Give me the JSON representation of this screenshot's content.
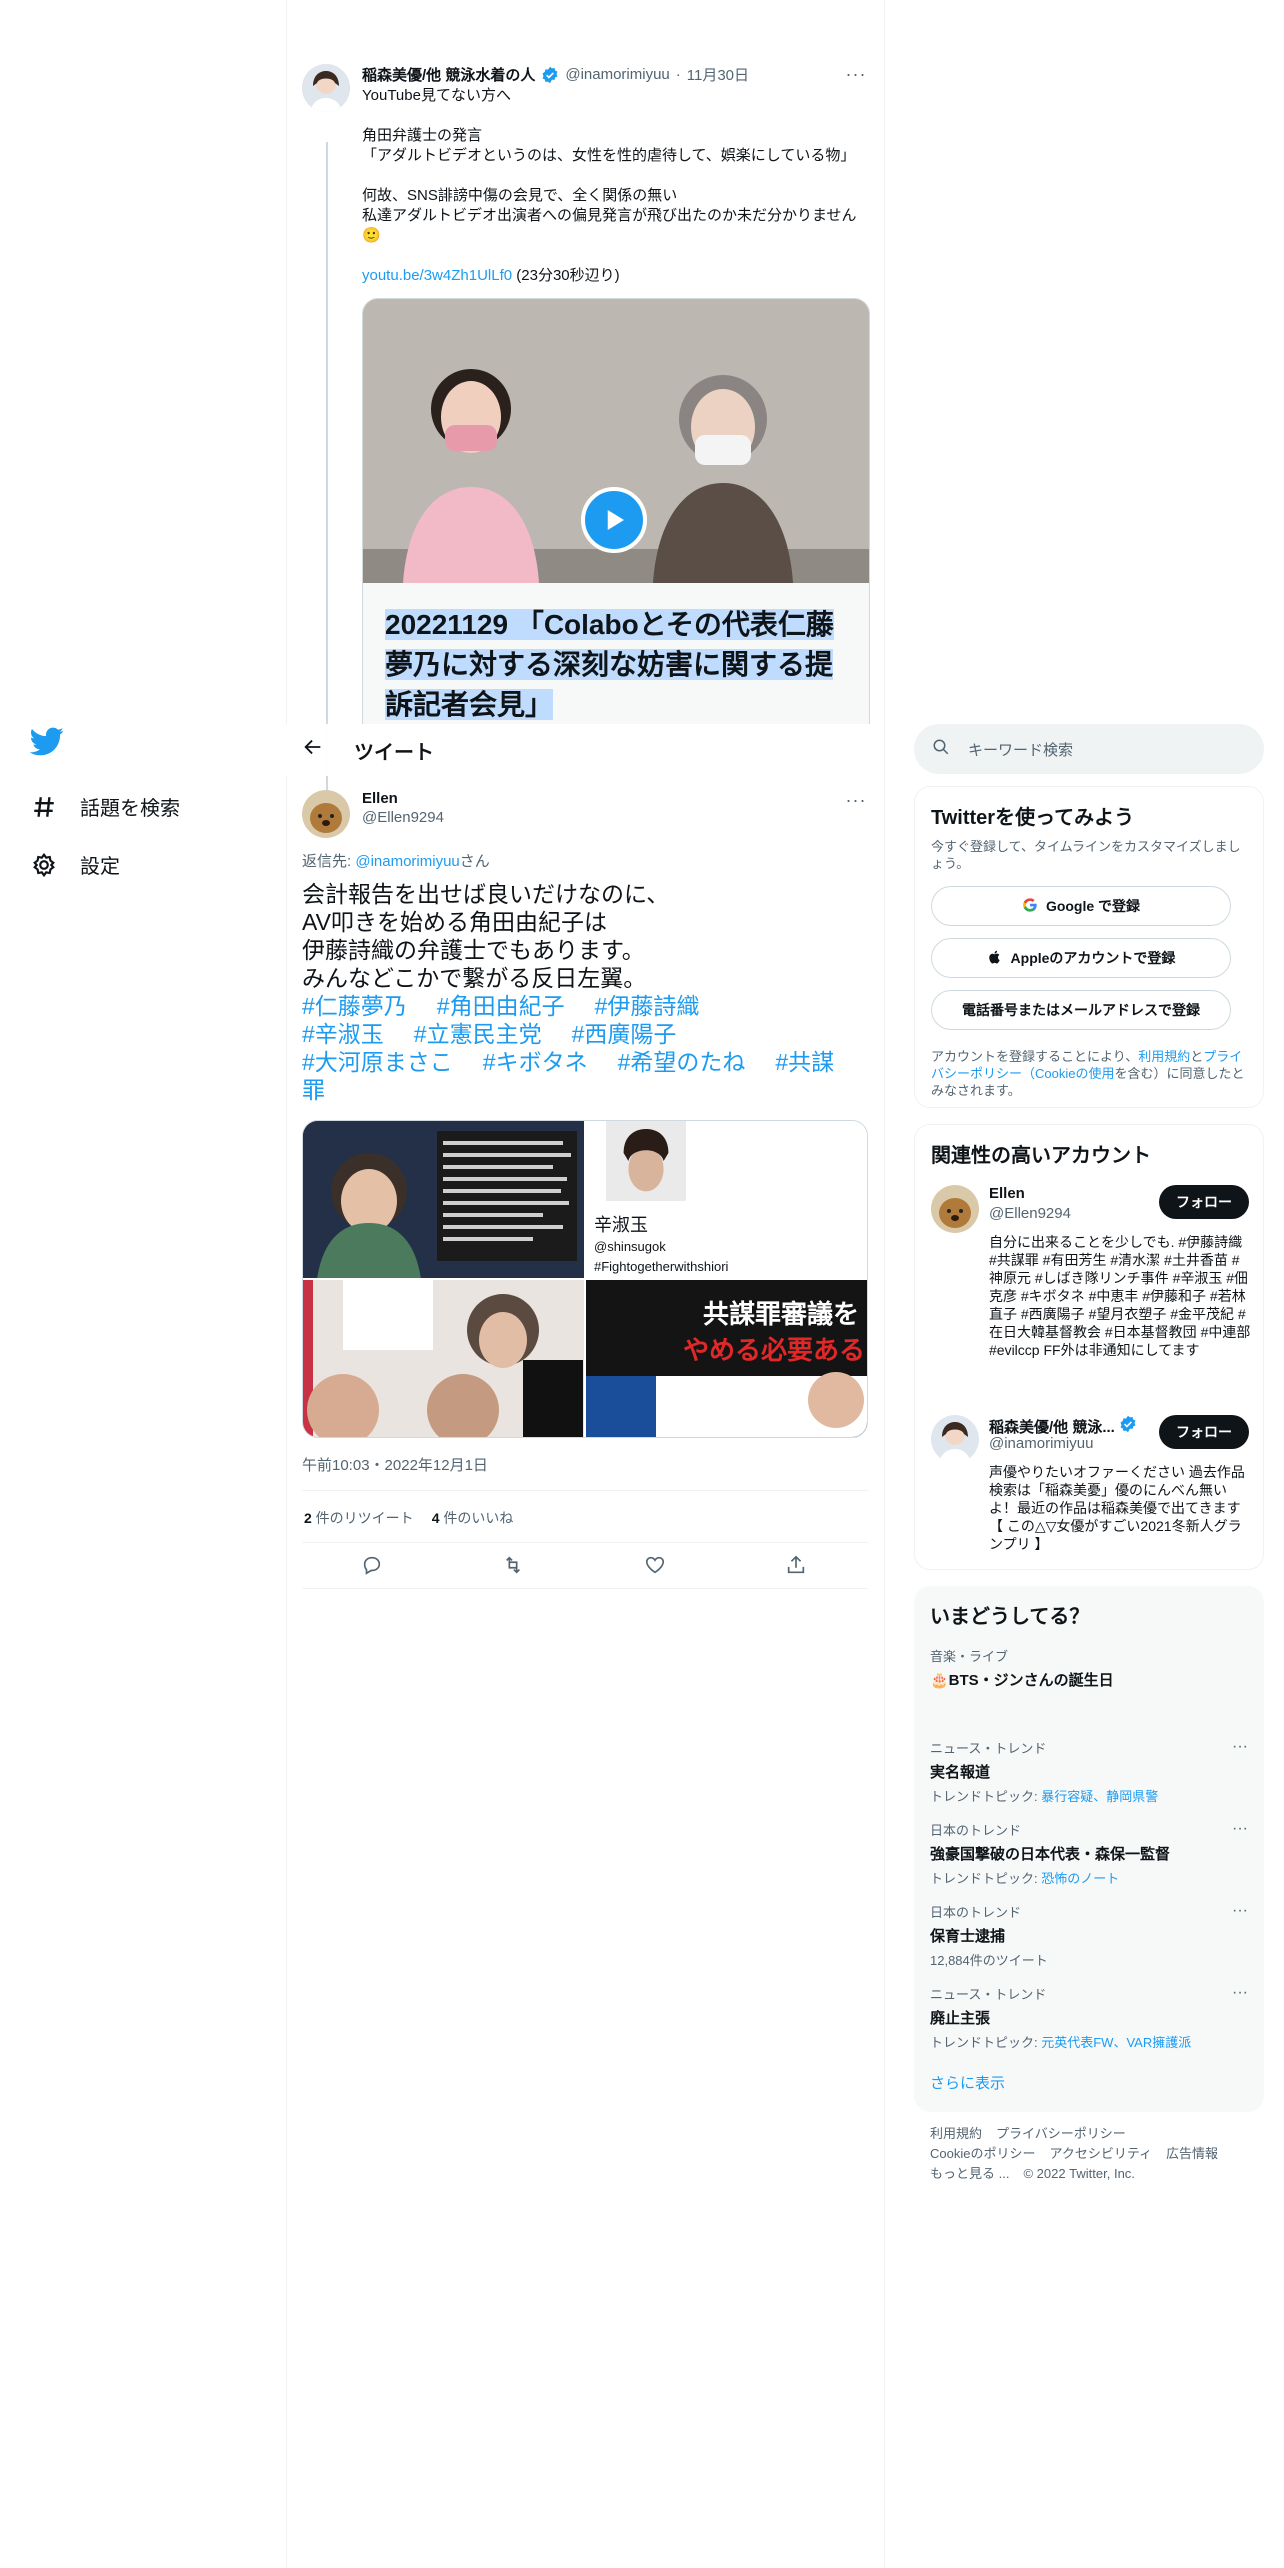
{
  "nav": {
    "items": [
      {
        "icon": "hashtag-icon",
        "label": "話題を検索"
      },
      {
        "icon": "gear-icon",
        "label": "設定"
      }
    ]
  },
  "quoted_tweet": {
    "name": "稲森美優/他 競泳水着の人",
    "handle": "@inamorimiyuu",
    "date": "11月30日",
    "lines": [
      "YouTube見てない方へ",
      "角田弁護士の発言",
      "「アダルトビデオというのは、女性を性的虐待して、娯楽にしている物」",
      "何故、SNS誹謗中傷の会見で、全く関係の無い",
      "私達アダルトビデオ出演者への偏見発言が飛び出たのか未だ分かりません"
    ],
    "link": "youtu.be/3w4Zh1UlLf0",
    "link_note": "(23分30秒辺り)",
    "card_caption": "20221129 「Colaboとその代表仁藤夢乃に対する深刻な妨害に関する提訴記者会見」"
  },
  "header": {
    "title": "ツイート"
  },
  "tweet": {
    "name": "Ellen",
    "handle": "@Ellen9294",
    "reply_prefix": "返信先: ",
    "reply_handle": "@inamorimiyuu",
    "reply_suffix": "さん",
    "lines": [
      "会計報告を出せば良いだけなのに、",
      "AV叩きを始める角田由紀子は",
      "伊藤詩織の弁護士でもあります。",
      "みんなどこかで繋がる反日左翼。"
    ],
    "hashtags": [
      "#仁藤夢乃",
      "#角田由紀子",
      "#伊藤詩織",
      "#辛淑玉",
      "#立憲民主党",
      "#西廣陽子",
      "#大河原まさこ",
      "#キボタネ",
      "#希望のたね",
      "#共謀罪"
    ],
    "media": {
      "m2_name": "辛淑玉",
      "m2_handle": "@shinsugok",
      "m2_tag": "#Fightogetherwithshiori",
      "m4_banner": "共謀罪審議を",
      "m4_banner2": "やめる必要ある"
    },
    "timestamp": "午前10:03・2022年12月1日",
    "retweets": "2",
    "retweets_label": " 件のリツイート",
    "likes": "4",
    "likes_label": " 件のいいね"
  },
  "right": {
    "search_placeholder": "キーワード検索",
    "signup": {
      "title": "Twitterを使ってみよう",
      "sub": "今すぐ登録して、タイムラインをカスタマイズしましょう。",
      "google": "Google で登録",
      "apple": "Appleのアカウントで登録",
      "phone": "電話番号またはメールアドレスで登録",
      "legal_a": "アカウントを登録することにより、",
      "legal_terms": "利用規約",
      "legal_b": "と",
      "legal_privacy": "プライバシーポリシー（Cookieの使用",
      "legal_c": "を含む）に同意したとみなされます。"
    },
    "related": {
      "title": "関連性の高いアカウント",
      "users": [
        {
          "name": "Ellen",
          "handle": "@Ellen9294",
          "follow": "フォロー",
          "bio": "自分に出来ることを少しでも. #伊藤詩織 #共謀罪 #有田芳生 #清水潔 #土井香苗 #神原元 #しばき隊リンチ事件 #辛淑玉 #佃克彦 #キボタネ #中恵丰 #伊藤和子 #若林直子 #西廣陽子 #望月衣塑子 #金平茂紀 #在日大韓基督教会 #日本基督教団 #中連部 #evilccp FF外は非通知にしてます"
        },
        {
          "name": "稲森美優/他 競泳...",
          "handle": "@inamorimiyuu",
          "follow": "フォロー",
          "bio": "声優やりたいオファーください 過去作品検索は「稲森美憂」優のにんべん無いよ！最近の作品は稲森美優で出てきます【 この△▽女優がすごい2021冬新人グランプリ 】"
        }
      ]
    },
    "trends": {
      "title": "いまどうしてる？",
      "items": [
        {
          "cat": "音楽・ライブ",
          "title": "🎂BTS・ジンさんの誕生日",
          "meta": "",
          "meta_link": ""
        },
        {
          "cat": "ニュース・トレンド",
          "title": "実名報道",
          "meta": "トレンドトピック: ",
          "meta_link": "暴行容疑、静岡県警"
        },
        {
          "cat": "日本のトレンド",
          "title": "強豪国撃破の日本代表・森保一監督",
          "meta": "トレンドトピック: ",
          "meta_link": "恐怖のノート"
        },
        {
          "cat": "日本のトレンド",
          "title": "保育士逮捕",
          "meta": "12,884件のツイート",
          "meta_link": ""
        },
        {
          "cat": "ニュース・トレンド",
          "title": "廃止主張",
          "meta": "トレンドトピック: ",
          "meta_link": "元英代表FW、VAR擁護派"
        }
      ],
      "more": "さらに表示"
    },
    "footer": {
      "l1": [
        "利用規約",
        "プライバシーポリシー"
      ],
      "l2": [
        "Cookieのポリシー",
        "アクセシビリティ",
        "広告情報"
      ],
      "l3": [
        "もっと見る ...",
        "© 2022 Twitter, Inc."
      ]
    }
  }
}
